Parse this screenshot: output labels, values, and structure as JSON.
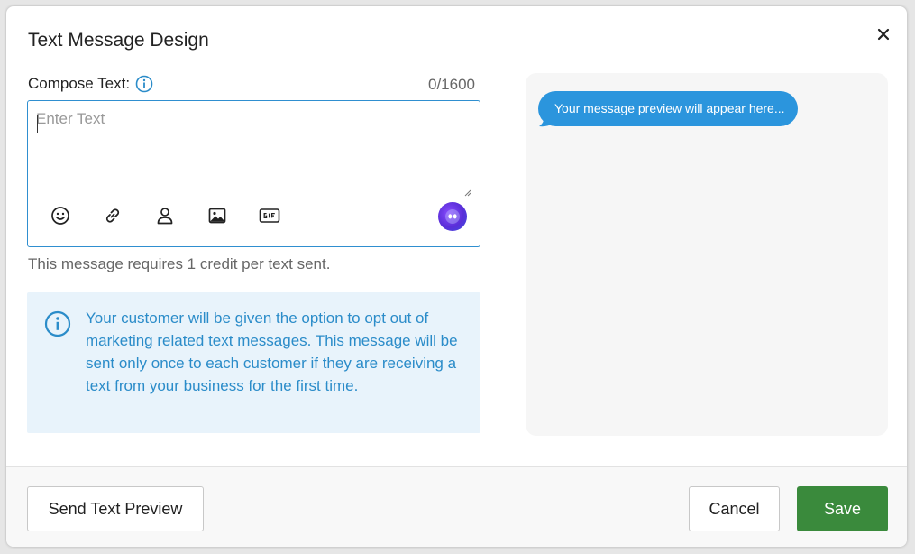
{
  "modal": {
    "title": "Text Message Design"
  },
  "compose": {
    "label": "Compose Text:",
    "counter": "0/1600",
    "placeholder": "Enter Text",
    "value": "",
    "toolbar": [
      "emoji-icon",
      "link-icon",
      "person-icon",
      "image-icon",
      "gif-icon",
      "ai-assistant-icon"
    ],
    "credit_note": "This message requires 1 credit per text sent."
  },
  "info_box": {
    "text": "Your customer will be given the option to opt out of marketing related text messages. This message will be sent only once to each customer if they are receiving a text from your business for the first time."
  },
  "preview": {
    "bubble_text": "Your message preview will appear here..."
  },
  "footer": {
    "send_preview_label": "Send Text Preview",
    "cancel_label": "Cancel",
    "save_label": "Save"
  },
  "colors": {
    "accent": "#2f8fd0",
    "bubble": "#2b95dd",
    "info_bg": "#e8f3fb",
    "info_text": "#2b8cc9",
    "save": "#3a8a3c"
  }
}
